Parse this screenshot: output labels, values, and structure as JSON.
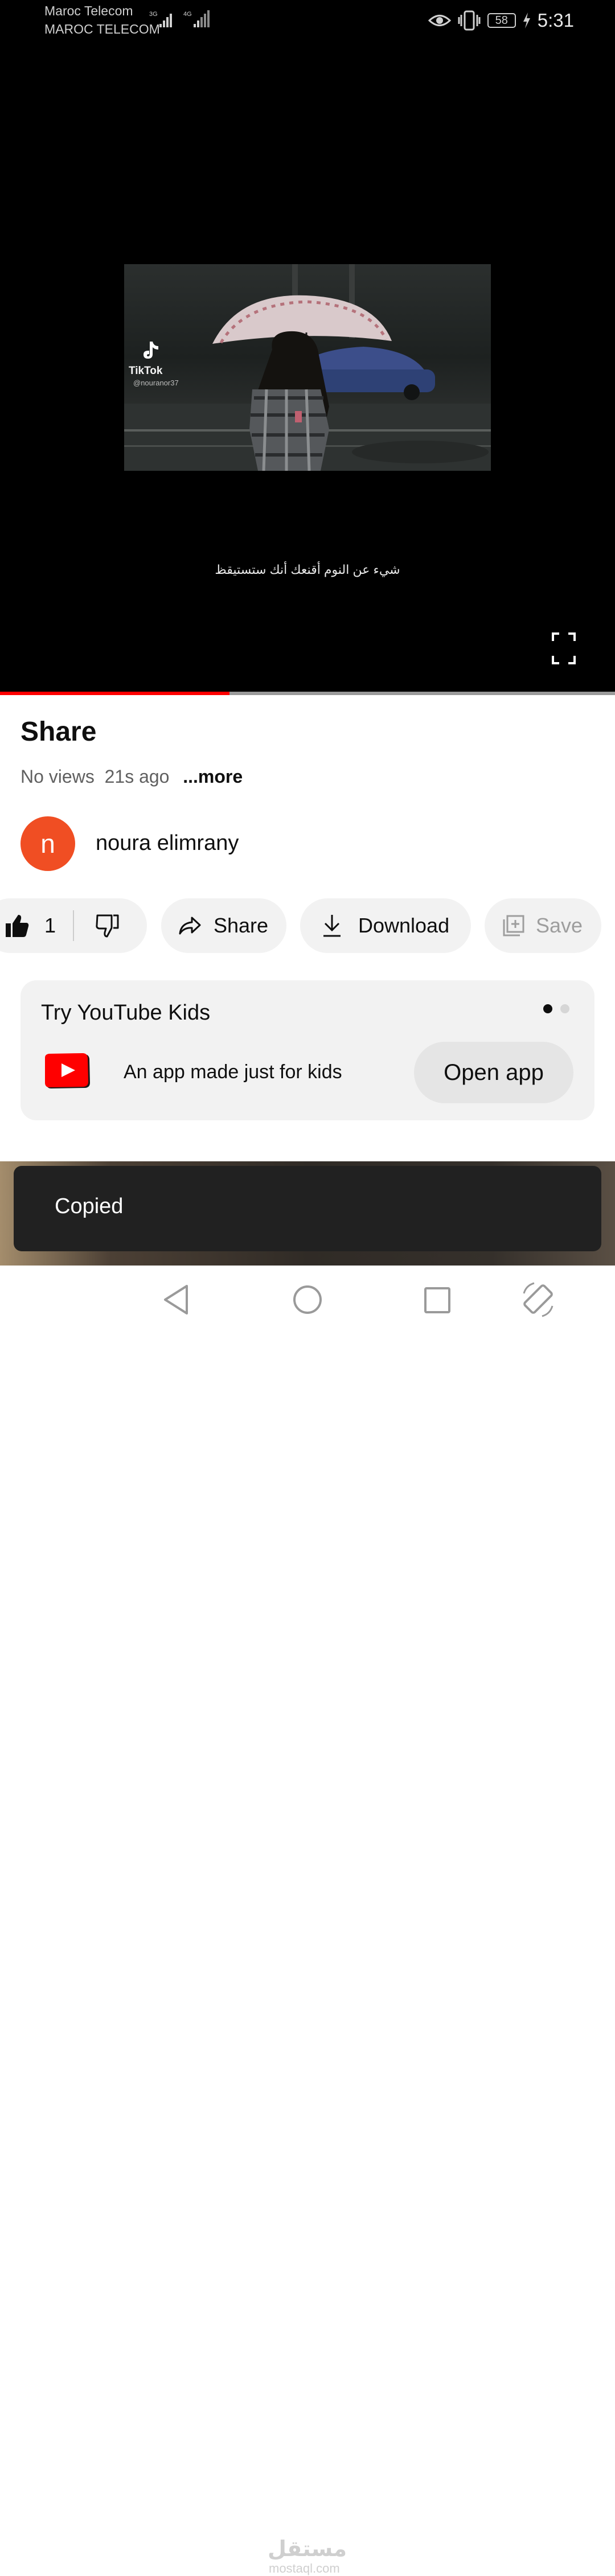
{
  "status_bar": {
    "carrier_1": "Maroc Telecom",
    "carrier_2": "MAROC TELECOM",
    "network_1": "3G",
    "network_2": "4G",
    "battery": "58",
    "time": "5:31"
  },
  "player": {
    "overlay_brand": "TikTok",
    "overlay_user": "@nouranor37",
    "caption": "شيء عن النوم أقنعك أنك ستستيقظ",
    "progress_fraction": 0.373,
    "colors": {
      "progress": "#ff0000",
      "track": "#9a9a9a"
    }
  },
  "video": {
    "title": "Share",
    "views": "No views",
    "age": "21s ago",
    "more_label": "...more"
  },
  "channel": {
    "avatar_letter": "n",
    "avatar_color": "#f04e23",
    "name": "noura elimrany"
  },
  "actions": {
    "like_count": "1",
    "share_label": "Share",
    "download_label": "Download",
    "save_label": "Save"
  },
  "promo": {
    "title": "Try YouTube Kids",
    "description": "An app made just for kids",
    "button_label": "Open app"
  },
  "toast": {
    "text": "Copied"
  },
  "watermark": {
    "text": "مستقل",
    "sub": "mostaql.com"
  },
  "icons": [
    "eye-icon",
    "vibrate-icon",
    "battery-icon",
    "charging-icon",
    "tiktok-icon",
    "fullscreen-icon",
    "like-icon",
    "dislike-icon",
    "share-icon",
    "download-icon",
    "save-icon",
    "youtube-kids-icon",
    "back-icon",
    "home-icon",
    "recents-icon",
    "rotate-icon"
  ]
}
